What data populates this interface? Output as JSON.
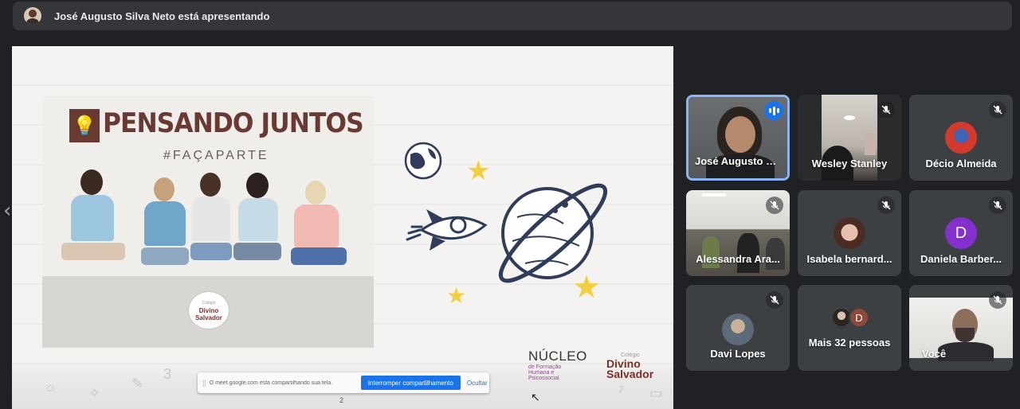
{
  "header": {
    "presenter_text": "José Augusto Silva Neto está apresentando"
  },
  "slide": {
    "poster_title": "PENSANDO JUNTOS",
    "poster_hashtag": "#FAÇAPARTE",
    "badge_line1": "Colégio",
    "badge_line2": "Divino",
    "badge_line3": "Salvador",
    "nucleo_title": "NÚCLEO",
    "nucleo_sub1": "de Formação",
    "nucleo_sub2": "Humana e",
    "nucleo_sub3": "Psicossocial",
    "divino_small": "Colégio",
    "divino_big1": "Divino",
    "divino_big2": "Salvador",
    "page_number": "2"
  },
  "share_bar": {
    "grip": "||",
    "message": "O meet.google.com está compartilhando sua tela.",
    "stop_label": "Interromper compartilhamento",
    "hide_label": "Ocultar"
  },
  "nav": {
    "prev": "‹",
    "next": "›"
  },
  "participants": [
    {
      "name": "José Augusto S...",
      "state": "speaking"
    },
    {
      "name": "Wesley Stanley",
      "state": "muted"
    },
    {
      "name": "Décio Almeida",
      "state": "muted"
    },
    {
      "name": "Alessandra Ara...",
      "state": "muted"
    },
    {
      "name": "Isabela bernard...",
      "state": "muted"
    },
    {
      "name": "Daniela Barber...",
      "state": "muted",
      "initial": "D"
    },
    {
      "name": "Davi Lopes",
      "state": "muted"
    },
    {
      "name": "Mais 32 pessoas",
      "initial": "D"
    },
    {
      "name": "Você",
      "state": "muted"
    }
  ],
  "colors": {
    "accent": "#8ab4f8",
    "speaking": "#1a73e8",
    "tile_bg": "#3c4043",
    "page_bg": "#202124"
  },
  "icons": [
    "mic-off-icon",
    "speaking-indicator-icon",
    "lightbulb-icon",
    "planet-icon",
    "rocket-icon",
    "globe-icon",
    "star-icon",
    "chevron-left-icon",
    "chevron-right-icon"
  ]
}
